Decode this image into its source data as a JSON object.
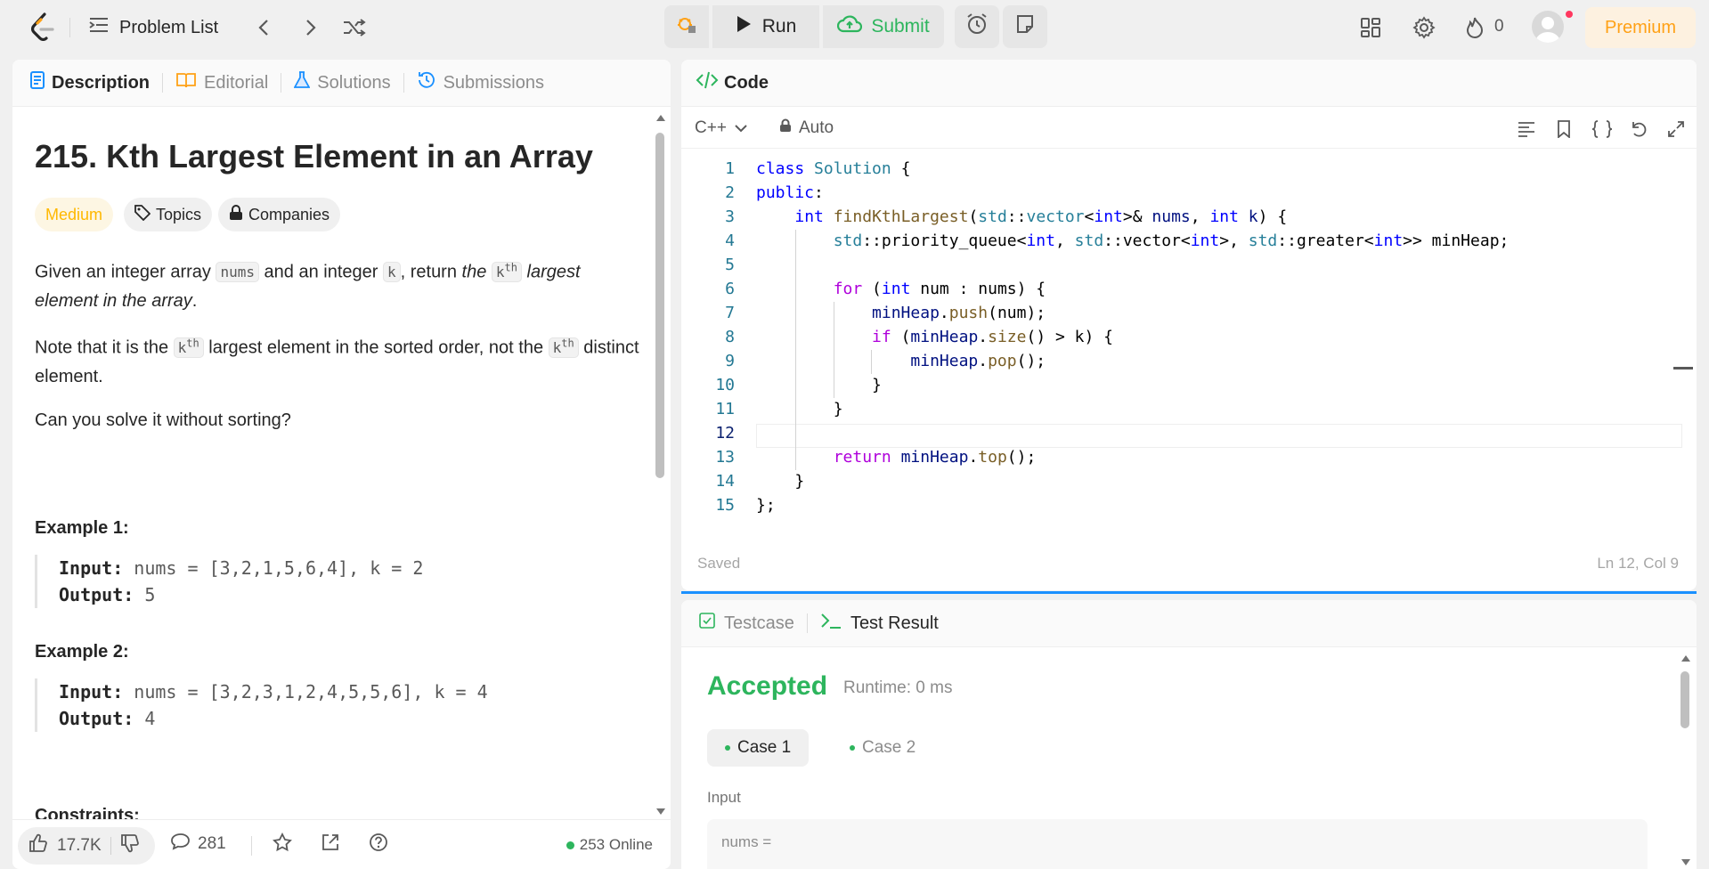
{
  "topbar": {
    "problem_list_label": "Problem List",
    "run_label": "Run",
    "submit_label": "Submit",
    "streak_count": "0",
    "premium_label": "Premium"
  },
  "left": {
    "tabs": [
      {
        "label": "Description"
      },
      {
        "label": "Editorial"
      },
      {
        "label": "Solutions"
      },
      {
        "label": "Submissions"
      }
    ],
    "title": "215. Kth Largest Element in an Array",
    "difficulty": "Medium",
    "topics_label": "Topics",
    "companies_label": "Companies",
    "para1_a": "Given an integer array ",
    "para1_code1": "nums",
    "para1_b": " and an integer ",
    "para1_code2": "k",
    "para1_c": ", return ",
    "para1_d": "the",
    "para1_k": "k",
    "para1_th": "th",
    "para1_e": " largest element in the array",
    "para1_f": ".",
    "para2_a": "Note that it is the ",
    "para2_b": " largest element in the sorted order, not the ",
    "para2_c": " distinct element.",
    "para3": "Can you solve it without sorting?",
    "example1_title": "Example 1:",
    "example1_input_label": "Input:",
    "example1_input": " nums = [3,2,1,5,6,4], k = 2",
    "example1_output_label": "Output:",
    "example1_output": " 5",
    "example2_title": "Example 2:",
    "example2_input_label": "Input:",
    "example2_input": " nums = [3,2,3,1,2,4,5,5,6], k = 4",
    "example2_output_label": "Output:",
    "example2_output": " 4",
    "constraints_title": "Constraints:",
    "likes": "17.7K",
    "comments": "281",
    "online": "253 Online"
  },
  "code": {
    "header_label": "Code",
    "language": "C++",
    "auto_label": "Auto",
    "saved_label": "Saved",
    "cursor_pos": "Ln 12, Col 9",
    "line_numbers": [
      "1",
      "2",
      "3",
      "4",
      "5",
      "6",
      "7",
      "8",
      "9",
      "10",
      "11",
      "12",
      "13",
      "14",
      "15"
    ]
  },
  "test": {
    "testcase_label": "Testcase",
    "result_label": "Test Result",
    "status": "Accepted",
    "runtime": "Runtime: 0 ms",
    "case1": "Case 1",
    "case2": "Case 2",
    "input_label": "Input",
    "input_value": "nums ="
  },
  "colors": {
    "accent_green": "#2db55d",
    "premium_orange": "#ffa116",
    "medium_yellow": "#ffb800",
    "split_blue": "#1a90ff"
  }
}
